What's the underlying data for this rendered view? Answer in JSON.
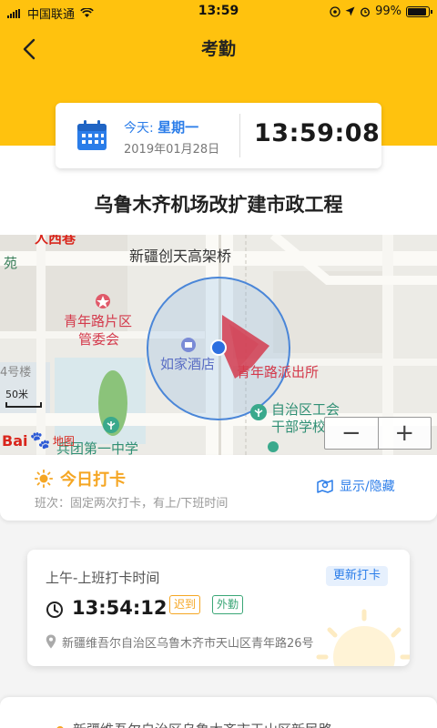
{
  "status_bar": {
    "carrier": "中国联通",
    "time": "13:59",
    "battery": "99%"
  },
  "header": {
    "title": "考勤"
  },
  "date_card": {
    "today_prefix": "今天:",
    "weekday": "星期一",
    "date": "2019年01月28日",
    "clock": "13:59:08"
  },
  "project": {
    "name": "乌鲁木齐机场改扩建市政工程"
  },
  "map": {
    "labels": {
      "top_left_fragment": "人西巷",
      "top_left_edge": "苑",
      "overpass": "新疆创天高架桥",
      "community": "青年路片区",
      "committee": "管委会",
      "building": "4号楼",
      "hotel": "如家酒店",
      "police": "青年路派出所",
      "union1": "自治区工会",
      "union2": "干部学校",
      "school": "兵团第一中学"
    },
    "scale": "50米",
    "logo_text": "Bai",
    "logo_suffix": "地图",
    "zoom_out": "−",
    "zoom_in": "+"
  },
  "punch_section": {
    "title": "今日打卡",
    "shift_info": "班次：固定两次打卡，有上/下班时间",
    "toggle_label": "显示/隐藏"
  },
  "record": {
    "label": "上午-上班打卡时间",
    "update_label": "更新打卡",
    "time": "13:54:12",
    "late_badge": "迟到",
    "field_badge": "外勤",
    "address": "新疆维吾尔自治区乌鲁木齐市天山区青年路26号"
  },
  "next_record": {
    "address": "新疆维吾尔自治区乌鲁木齐市天山区新民路"
  },
  "colors": {
    "brand_yellow": "#ffc20e",
    "accent_blue": "#2b7de9",
    "warning_orange": "#f5a623",
    "field_green": "#3aa676"
  }
}
